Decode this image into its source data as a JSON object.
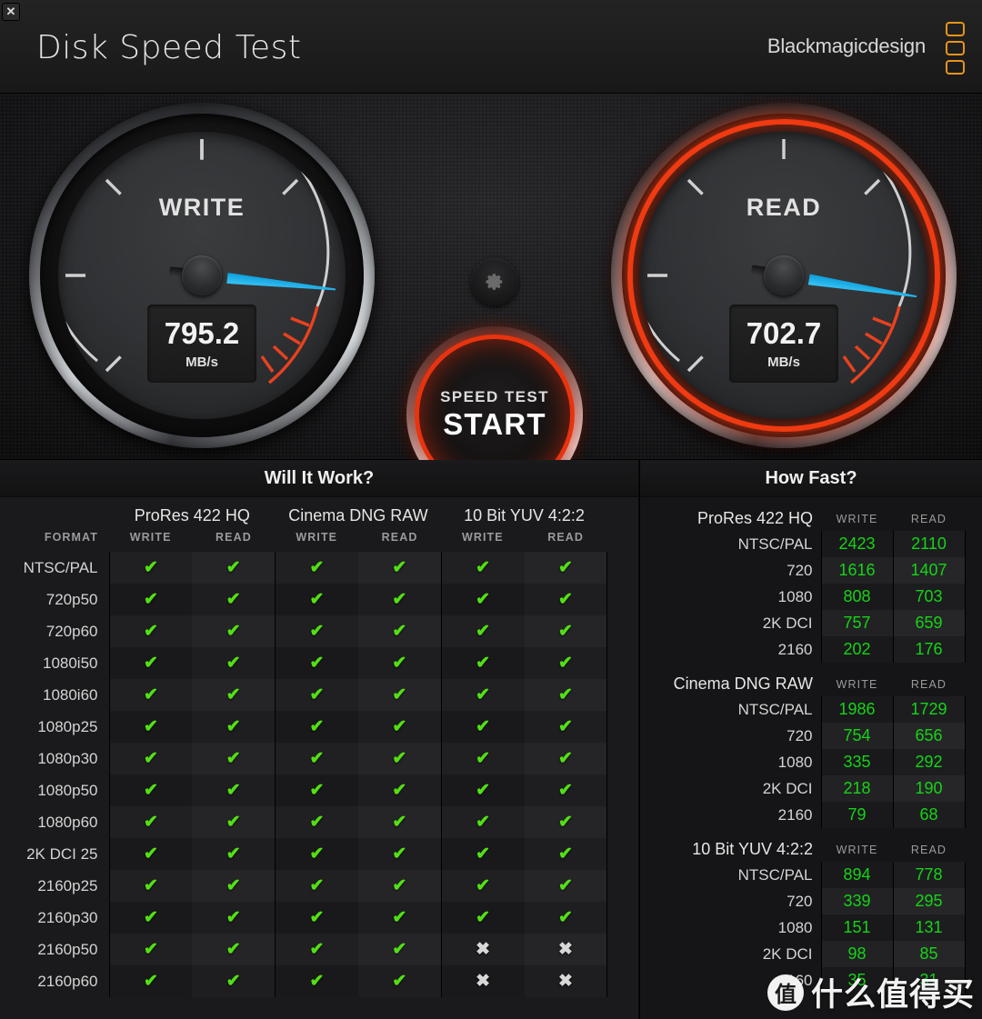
{
  "window": {
    "close_label": "✕",
    "app_title": "Disk Speed Test",
    "brand": "Blackmagicdesign"
  },
  "gauges": {
    "write": {
      "label": "WRITE",
      "value": "795.2",
      "unit": "MB/s",
      "needle_angle_deg": 186,
      "active": false
    },
    "read": {
      "label": "READ",
      "value": "702.7",
      "unit": "MB/s",
      "needle_angle_deg": 189,
      "active": true,
      "glow_color": "#ef3a12"
    }
  },
  "start_button": {
    "line1": "SPEED TEST",
    "line2": "START",
    "ring_color": "#e8330f"
  },
  "settings_icon": "gear-icon",
  "will_it_work": {
    "title": "Will It Work?",
    "format_header": "FORMAT",
    "groups": [
      {
        "name": "ProRes 422 HQ",
        "columns": [
          "WRITE",
          "READ"
        ]
      },
      {
        "name": "Cinema DNG RAW",
        "columns": [
          "WRITE",
          "READ"
        ]
      },
      {
        "name": "10 Bit YUV 4:2:2",
        "columns": [
          "WRITE",
          "READ"
        ]
      }
    ],
    "mark_ok": "✔",
    "mark_no": "✖",
    "rows": [
      {
        "format": "NTSC/PAL",
        "marks": [
          true,
          true,
          true,
          true,
          true,
          true
        ]
      },
      {
        "format": "720p50",
        "marks": [
          true,
          true,
          true,
          true,
          true,
          true
        ]
      },
      {
        "format": "720p60",
        "marks": [
          true,
          true,
          true,
          true,
          true,
          true
        ]
      },
      {
        "format": "1080i50",
        "marks": [
          true,
          true,
          true,
          true,
          true,
          true
        ]
      },
      {
        "format": "1080i60",
        "marks": [
          true,
          true,
          true,
          true,
          true,
          true
        ]
      },
      {
        "format": "1080p25",
        "marks": [
          true,
          true,
          true,
          true,
          true,
          true
        ]
      },
      {
        "format": "1080p30",
        "marks": [
          true,
          true,
          true,
          true,
          true,
          true
        ]
      },
      {
        "format": "1080p50",
        "marks": [
          true,
          true,
          true,
          true,
          true,
          true
        ]
      },
      {
        "format": "1080p60",
        "marks": [
          true,
          true,
          true,
          true,
          true,
          true
        ]
      },
      {
        "format": "2K DCI 25",
        "marks": [
          true,
          true,
          true,
          true,
          true,
          true
        ]
      },
      {
        "format": "2160p25",
        "marks": [
          true,
          true,
          true,
          true,
          true,
          true
        ]
      },
      {
        "format": "2160p30",
        "marks": [
          true,
          true,
          true,
          true,
          true,
          true
        ]
      },
      {
        "format": "2160p50",
        "marks": [
          true,
          true,
          true,
          true,
          false,
          false
        ]
      },
      {
        "format": "2160p60",
        "marks": [
          true,
          true,
          true,
          true,
          false,
          false
        ]
      }
    ]
  },
  "how_fast": {
    "title": "How Fast?",
    "col_write": "WRITE",
    "col_read": "READ",
    "groups": [
      {
        "name": "ProRes 422 HQ",
        "rows": [
          {
            "label": "NTSC/PAL",
            "write": "2423",
            "read": "2110"
          },
          {
            "label": "720",
            "write": "1616",
            "read": "1407"
          },
          {
            "label": "1080",
            "write": "808",
            "read": "703"
          },
          {
            "label": "2K DCI",
            "write": "757",
            "read": "659"
          },
          {
            "label": "2160",
            "write": "202",
            "read": "176"
          }
        ]
      },
      {
        "name": "Cinema DNG RAW",
        "rows": [
          {
            "label": "NTSC/PAL",
            "write": "1986",
            "read": "1729"
          },
          {
            "label": "720",
            "write": "754",
            "read": "656"
          },
          {
            "label": "1080",
            "write": "335",
            "read": "292"
          },
          {
            "label": "2K DCI",
            "write": "218",
            "read": "190"
          },
          {
            "label": "2160",
            "write": "79",
            "read": "68"
          }
        ]
      },
      {
        "name": "10 Bit YUV 4:2:2",
        "rows": [
          {
            "label": "NTSC/PAL",
            "write": "894",
            "read": "778"
          },
          {
            "label": "720",
            "write": "339",
            "read": "295"
          },
          {
            "label": "1080",
            "write": "151",
            "read": "131"
          },
          {
            "label": "2K DCI",
            "write": "98",
            "read": "85"
          },
          {
            "label": "2160",
            "write": "35",
            "read": "31"
          }
        ]
      }
    ]
  },
  "watermark": {
    "badge": "值",
    "text": "什么值得买"
  },
  "colors": {
    "accent_green": "#15d415",
    "check_green": "#52e014",
    "red_ring": "#e8330f",
    "needle_blue": "#29b6ea",
    "brand_orange": "#e8941a"
  }
}
